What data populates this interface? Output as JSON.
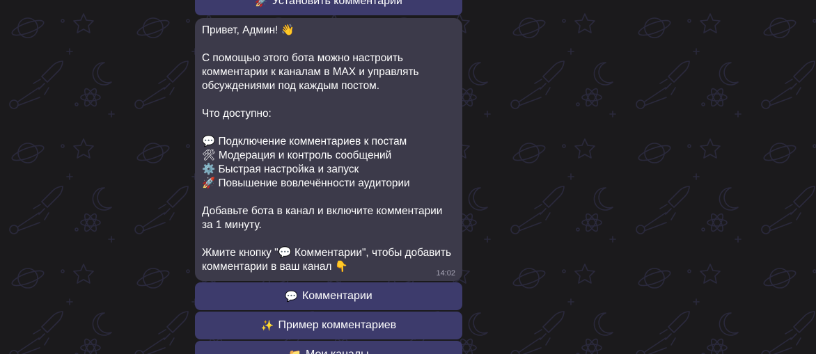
{
  "colors": {
    "background": "#1b1a1c",
    "bubble": "#3c3a4a",
    "button": "#3d3b6c",
    "text": "#ffffff",
    "time": "#a9a7b8"
  },
  "top_button": {
    "icon": "🚀",
    "icon_name": "rocket-icon",
    "label": "Установить комментарии"
  },
  "message": {
    "text": "Привет, Админ! 👋\n\nС помощью этого бота можно настроить комментарии к каналам в MAX и управлять обсуждениями под каждым постом.\n\nЧто доступно:\n\n💬 Подключение комментариев к постам\n🛠 Модерация и контроль сообщений\n⚙️ Быстрая настройка и запуск\n🚀 Повышение вовлечённости аудитории\n\nДобавьте бота в канал и включите комментарии за 1 минуту.\n\nЖмите кнопку \"💬 Комментарии\", чтобы добавить комментарии в ваш канал 👇",
    "time": "14:02"
  },
  "buttons": [
    {
      "icon": "💬",
      "icon_name": "speech-bubble-icon",
      "label": "Комментарии"
    },
    {
      "icon": "✨",
      "icon_name": "sparkles-icon",
      "label": "Пример комментариев"
    },
    {
      "icon": "📁",
      "icon_name": "folder-icon",
      "label": "Мои каналы"
    }
  ]
}
